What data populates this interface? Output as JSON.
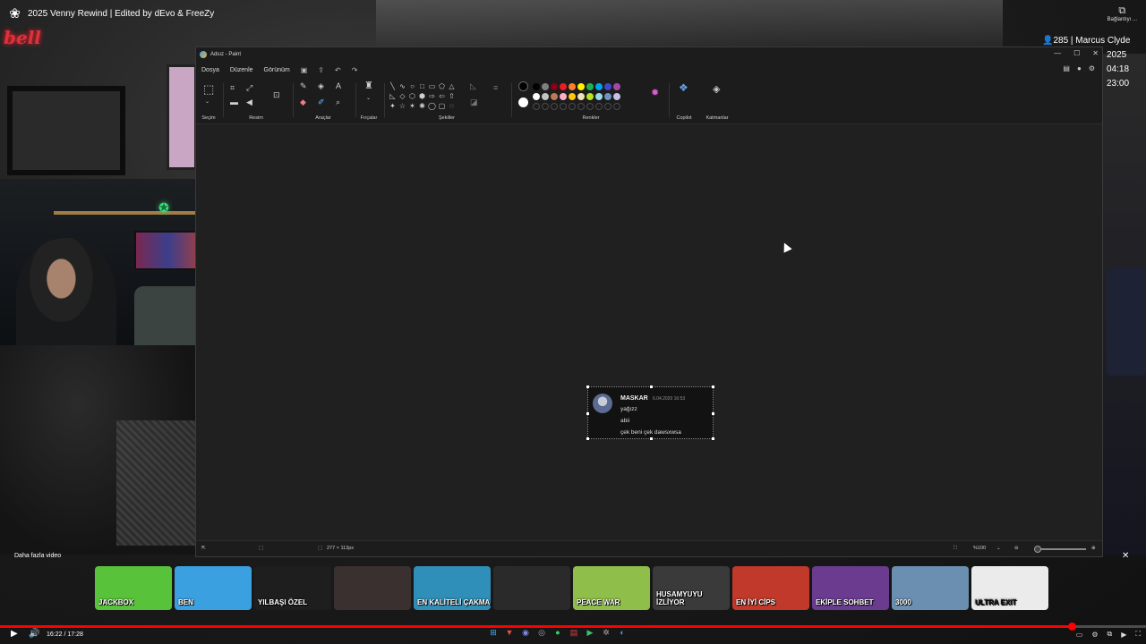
{
  "video": {
    "title": "2025 Venny Rewind | Edited by dEvo & FreeZy",
    "connection_label": "Bağlantıyı ..."
  },
  "overlay": {
    "players": "285 | Marcus Clyde",
    "year": "2025",
    "clock": "04:18",
    "clock2": "23:00"
  },
  "paint": {
    "window_title": "Adsız - Paint",
    "menu": [
      "Dosya",
      "Düzenle",
      "Görünüm"
    ],
    "groups": {
      "selection": "Seçim",
      "image": "Resim",
      "tools": "Araçlar",
      "brushes": "Fırçalar",
      "shapes": "Şekiller",
      "colors": "Renkler",
      "copilot": "Copilot",
      "layers": "Katmanlar"
    },
    "shape_glyphs": [
      "╲",
      "∿",
      "○",
      "□",
      "▭",
      "⬠",
      "△",
      "◺",
      "◇",
      "⬡",
      "⬢",
      "⇨",
      "⇦",
      "⇧",
      "✦",
      "☆",
      "✶",
      "✺",
      "◯",
      "▢",
      "◌"
    ],
    "palette_row1": [
      "#000000",
      "#7f7f7f",
      "#880015",
      "#ed1c24",
      "#ff7f27",
      "#fff200",
      "#22b14c",
      "#00a2e8",
      "#3f48cc",
      "#a349a4"
    ],
    "palette_row2": [
      "#ffffff",
      "#c3c3c3",
      "#b97a57",
      "#ffaec9",
      "#ffc90e",
      "#efe4b0",
      "#b5e61d",
      "#99d9ea",
      "#7092be",
      "#c8bfe7"
    ],
    "status": {
      "size": "277 × 113px",
      "zoom": "%100"
    }
  },
  "message": {
    "username": "MASKAR",
    "date": "6.04.2020 16:53",
    "lines": [
      "yağızz",
      "abii",
      "çek beni çek dawsxwsa"
    ]
  },
  "strip": {
    "label": "Daha fazla video",
    "thumbs": [
      {
        "text": "JACKBOX",
        "bg": "#58c23a"
      },
      {
        "text": "BEN",
        "bg": "#3aa0e0"
      },
      {
        "text": "YILBAŞI ÖZEL",
        "bg": "#1e1e1e"
      },
      {
        "text": "",
        "bg": "#3a3030"
      },
      {
        "text": "EN KALİTELİ ÇAKMA",
        "bg": "#2f8fb8"
      },
      {
        "text": "",
        "bg": "#2a2a2a"
      },
      {
        "text": "PEACE WAR",
        "bg": "#8fbf4a"
      },
      {
        "text": "HUSAMYUYU İZLİYOR",
        "bg": "#3a3a3a"
      },
      {
        "text": "EN İYİ CİPS",
        "bg": "#c0392b"
      },
      {
        "text": "EKİPLE SOHBET",
        "bg": "#6a3b8f"
      },
      {
        "text": "3000",
        "bg": "#6a8fb0"
      },
      {
        "text": "ULTRA EXIT",
        "bg": "#ebebeb"
      }
    ]
  },
  "player": {
    "time": "16:22 / 17:28",
    "progress": 0.9351
  }
}
